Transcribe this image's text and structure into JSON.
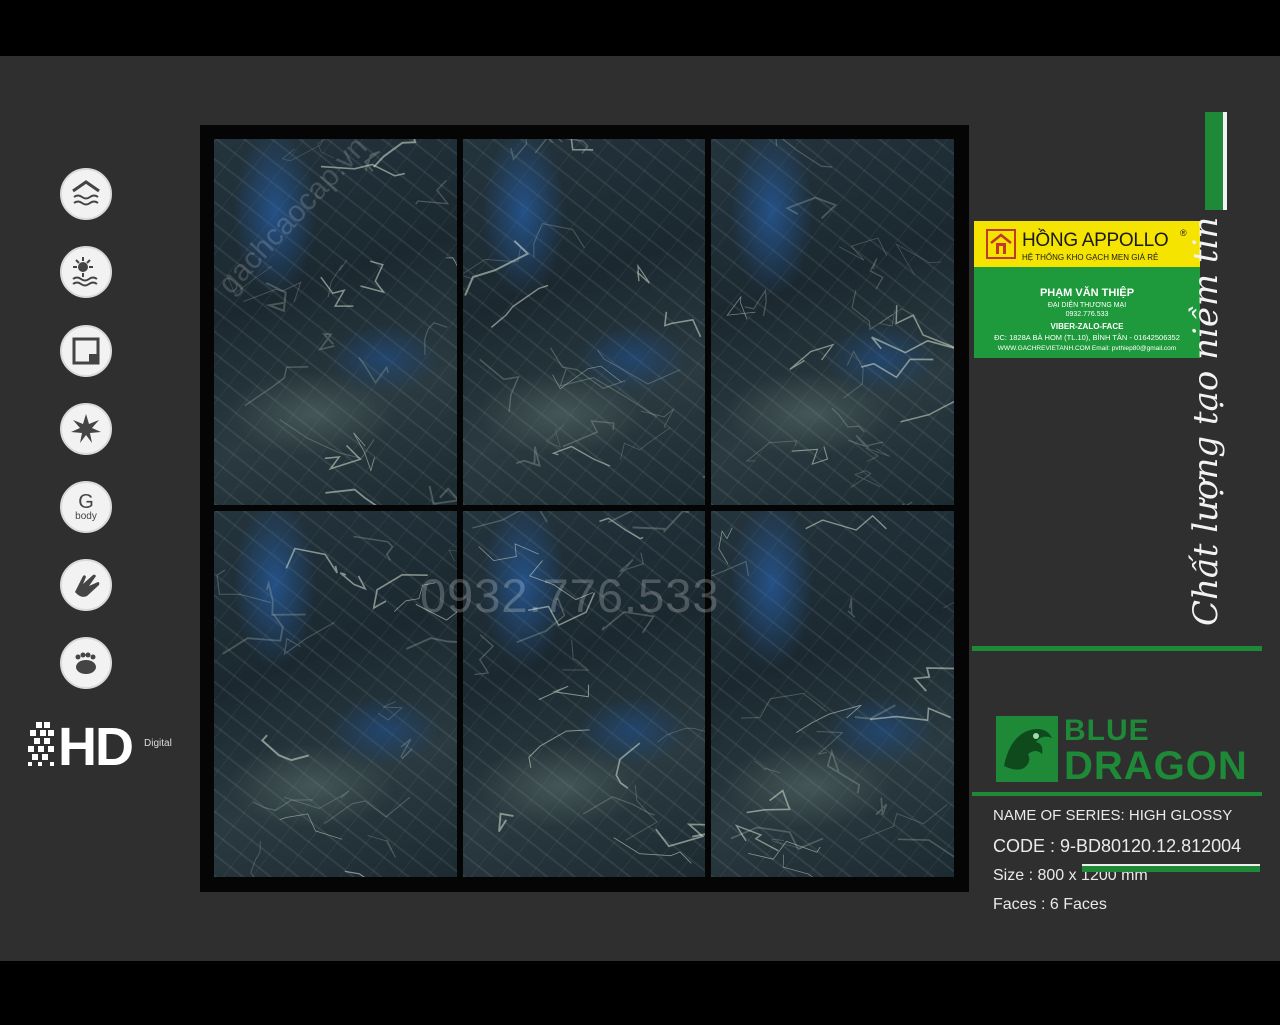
{
  "icons": [
    {
      "name": "wall-tile-icon"
    },
    {
      "name": "sun-water-icon"
    },
    {
      "name": "square-tile-icon"
    },
    {
      "name": "starburst-icon"
    },
    {
      "name": "g-body-icon",
      "letter": "G",
      "caption": "body"
    },
    {
      "name": "hand-icon"
    },
    {
      "name": "foot-icon"
    }
  ],
  "hd_logo": {
    "text": "HD",
    "sub": "Digital"
  },
  "watermark": {
    "site": "gachcaocap.vn",
    "phone": "0932.776.533"
  },
  "card": {
    "brand": "HỒNG APPOLLO",
    "registered": "®",
    "tagline": "HỆ THỐNG KHO GẠCH MEN GIÁ RẺ",
    "rep_name": "PHẠM VĂN THIỆP",
    "rep_role": "ĐẠI DIỆN THƯƠNG MẠI",
    "rep_phone": "0932.776.533",
    "contact": "VIBER-ZALO-FACE",
    "address": "ĐC: 1828A BÀ HOM (TL.10), BÌNH TÂN - 01642506352",
    "web": "WWW.GACHREVIETANH.COM Email: pvthiep80@gmail.com"
  },
  "slogan": "Chất lượng tạo niềm tin",
  "brand": {
    "line1": "BLUE",
    "line2": "DRAGON"
  },
  "specs": {
    "series": "NAME OF SERIES:  HIGH GLOSSY",
    "code": "CODE  :  9-BD80120.12.812004",
    "size": "Size    :  800 x 1200 mm",
    "faces": "Faces  :  6 Faces"
  },
  "colors": {
    "accent_green": "#1e8a38",
    "card_yellow": "#f4e400",
    "panel": "#2f2f2f"
  }
}
